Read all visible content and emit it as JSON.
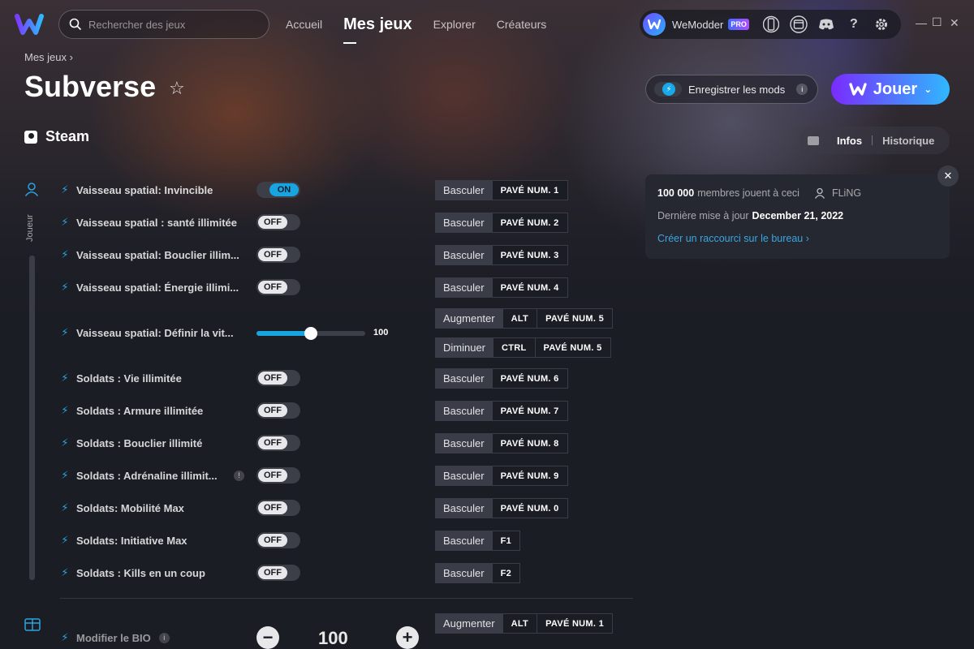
{
  "app": {
    "search_placeholder": "Rechercher des jeux",
    "nav": [
      "Accueil",
      "Mes jeux",
      "Explorer",
      "Créateurs"
    ],
    "account_name": "WeModder",
    "pro_badge": "PRO",
    "window_controls": [
      "—",
      "☐",
      "✕"
    ]
  },
  "header": {
    "breadcrumb": "Mes jeux ›",
    "title": "Subverse",
    "platform": "Steam",
    "save_mods_label": "Enregistrer les mods",
    "play_label": "Jouer"
  },
  "info_panel": {
    "tabs": [
      "Infos",
      "Historique"
    ],
    "players_count": "100 000",
    "players_text": "membres jouent à ceci",
    "creator": "FLiNG",
    "updated_label": "Dernière mise à jour",
    "updated_date": "December 21, 2022",
    "shortcut_link": "Créer un raccourci sur le bureau ›"
  },
  "sidebar": {
    "player_label": "Joueur"
  },
  "mods": [
    {
      "name": "Vaisseau spatial: Invincible",
      "state": "ON",
      "action": "Basculer",
      "keys": [
        "PAVÉ NUM. 1"
      ]
    },
    {
      "name": "Vaisseau spatial : santé illimitée",
      "state": "OFF",
      "action": "Basculer",
      "keys": [
        "PAVÉ NUM. 2"
      ]
    },
    {
      "name": "Vaisseau spatial: Bouclier illim...",
      "state": "OFF",
      "action": "Basculer",
      "keys": [
        "PAVÉ NUM. 3"
      ]
    },
    {
      "name": "Vaisseau spatial: Énergie illimi...",
      "state": "OFF",
      "action": "Basculer",
      "keys": [
        "PAVÉ NUM. 4"
      ]
    },
    {
      "name": "Vaisseau spatial: Définir la vit...",
      "slider_value": "100",
      "slider_fraction": 0.5,
      "increase_action": "Augmenter",
      "increase_keys": [
        "ALT",
        "PAVÉ NUM. 5"
      ],
      "decrease_action": "Diminuer",
      "decrease_keys": [
        "CTRL",
        "PAVÉ NUM. 5"
      ]
    },
    {
      "name": "Soldats : Vie illimitée",
      "state": "OFF",
      "action": "Basculer",
      "keys": [
        "PAVÉ NUM. 6"
      ]
    },
    {
      "name": "Soldats : Armure illimitée",
      "state": "OFF",
      "action": "Basculer",
      "keys": [
        "PAVÉ NUM. 7"
      ]
    },
    {
      "name": "Soldats : Bouclier illimité",
      "state": "OFF",
      "action": "Basculer",
      "keys": [
        "PAVÉ NUM. 8"
      ]
    },
    {
      "name": "Soldats : Adrénaline illimit...",
      "state": "OFF",
      "action": "Basculer",
      "keys": [
        "PAVÉ NUM. 9"
      ],
      "info": "!"
    },
    {
      "name": "Soldats: Mobilité Max",
      "state": "OFF",
      "action": "Basculer",
      "keys": [
        "PAVÉ NUM. 0"
      ]
    },
    {
      "name": "Soldats: Initiative Max",
      "state": "OFF",
      "action": "Basculer",
      "keys": [
        "F1"
      ]
    },
    {
      "name": "Soldats : Kills en un coup",
      "state": "OFF",
      "action": "Basculer",
      "keys": [
        "F2"
      ]
    }
  ],
  "bio_mod": {
    "name": "Modifier le BIO",
    "info": "i",
    "value": "100",
    "minus": "−",
    "plus": "+",
    "action": "Augmenter",
    "keys": [
      "ALT",
      "PAVÉ NUM. 1"
    ]
  }
}
